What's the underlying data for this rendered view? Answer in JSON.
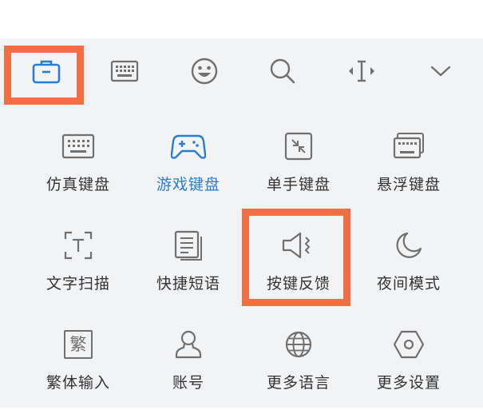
{
  "colors": {
    "accent": "#2a7dd1",
    "highlight": "#f26f44",
    "panel_bg": "#f2f3f5",
    "icon_gray": "#707070",
    "text": "#333333"
  },
  "toolbar": {
    "items": [
      {
        "icon": "toolbox-icon",
        "selected": true
      },
      {
        "icon": "keyboard-icon"
      },
      {
        "icon": "emoji-icon"
      },
      {
        "icon": "search-icon"
      },
      {
        "icon": "text-cursor-icon"
      },
      {
        "icon": "chevron-down-icon"
      }
    ]
  },
  "tools": [
    {
      "label": "仿真键盘",
      "icon": "keyboard-icon"
    },
    {
      "label": "游戏键盘",
      "icon": "gamepad-icon",
      "active": true
    },
    {
      "label": "单手键盘",
      "icon": "one-hand-icon"
    },
    {
      "label": "悬浮键盘",
      "icon": "floating-keyboard-icon"
    },
    {
      "label": "文字扫描",
      "icon": "scan-text-icon"
    },
    {
      "label": "快捷短语",
      "icon": "phrases-icon"
    },
    {
      "label": "按键反馈",
      "icon": "speaker-icon",
      "highlighted": true
    },
    {
      "label": "夜间模式",
      "icon": "moon-icon"
    },
    {
      "label": "繁体输入",
      "icon": "traditional-char-icon",
      "icon_text": "繁"
    },
    {
      "label": "账号",
      "icon": "account-icon"
    },
    {
      "label": "更多语言",
      "icon": "globe-icon"
    },
    {
      "label": "更多设置",
      "icon": "hexagon-settings-icon"
    }
  ]
}
